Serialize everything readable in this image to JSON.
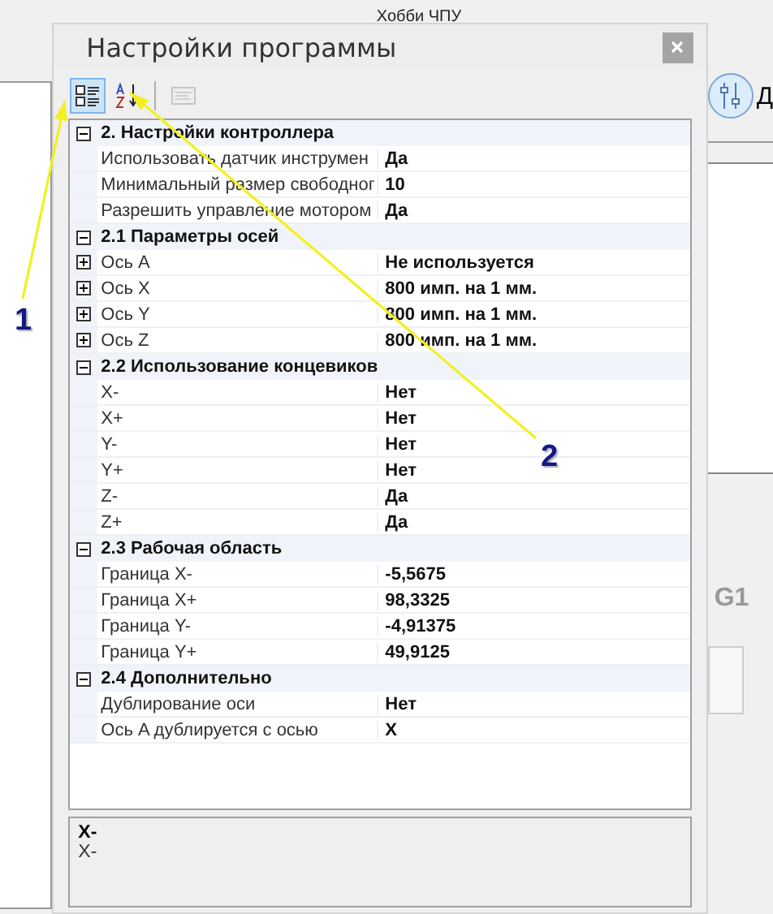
{
  "app": {
    "title": "Хобби ЧПУ",
    "side_button_label": "Д",
    "side_text": "G1"
  },
  "dialog": {
    "title": "Настройки программы",
    "toolbar": [
      {
        "kind": "categorized",
        "selected": true,
        "disabled": false
      },
      {
        "kind": "alphabetical",
        "selected": false,
        "disabled": false
      },
      {
        "kind": "pages",
        "selected": false,
        "disabled": true
      }
    ],
    "categories": [
      {
        "title": "2. Настройки контроллера",
        "expanded": true,
        "properties": [
          {
            "name": "Использовать датчик инструмен",
            "value": "Да"
          },
          {
            "name": "Минимальный размер свободног",
            "value": "10"
          },
          {
            "name": "Разрешить управление мотором",
            "value": "Да"
          }
        ]
      },
      {
        "title": "2.1 Параметры осей",
        "expanded": true,
        "properties": [
          {
            "name": "Ось A",
            "value": "Не используется",
            "expanded": false
          },
          {
            "name": "Ось X",
            "value": "800 имп. на 1 мм.",
            "expanded": false
          },
          {
            "name": "Ось Y",
            "value": "800 имп. на 1 мм.",
            "expanded": false
          },
          {
            "name": "Ось Z",
            "value": "800 имп. на 1 мм.",
            "expanded": false
          }
        ]
      },
      {
        "title": "2.2 Использование концевиков",
        "expanded": true,
        "properties": [
          {
            "name": "X-",
            "value": "Нет"
          },
          {
            "name": "X+",
            "value": "Нет"
          },
          {
            "name": "Y-",
            "value": "Нет"
          },
          {
            "name": "Y+",
            "value": "Нет"
          },
          {
            "name": "Z-",
            "value": "Да"
          },
          {
            "name": "Z+",
            "value": "Да"
          }
        ]
      },
      {
        "title": "2.3 Рабочая область",
        "expanded": true,
        "properties": [
          {
            "name": "Граница X-",
            "value": "-5,5675"
          },
          {
            "name": "Граница X+",
            "value": "98,3325"
          },
          {
            "name": "Граница Y-",
            "value": "-4,91375"
          },
          {
            "name": "Граница Y+",
            "value": "49,9125"
          }
        ]
      },
      {
        "title": "2.4 Дополнительно",
        "expanded": true,
        "properties": [
          {
            "name": "Дублирование оси",
            "value": "Нет"
          },
          {
            "name": "Ось A дублируется с осью",
            "value": "X"
          }
        ]
      }
    ],
    "description": {
      "title": "X-",
      "text": "X-"
    }
  },
  "annotations": [
    {
      "label": "1"
    },
    {
      "label": "2"
    }
  ]
}
